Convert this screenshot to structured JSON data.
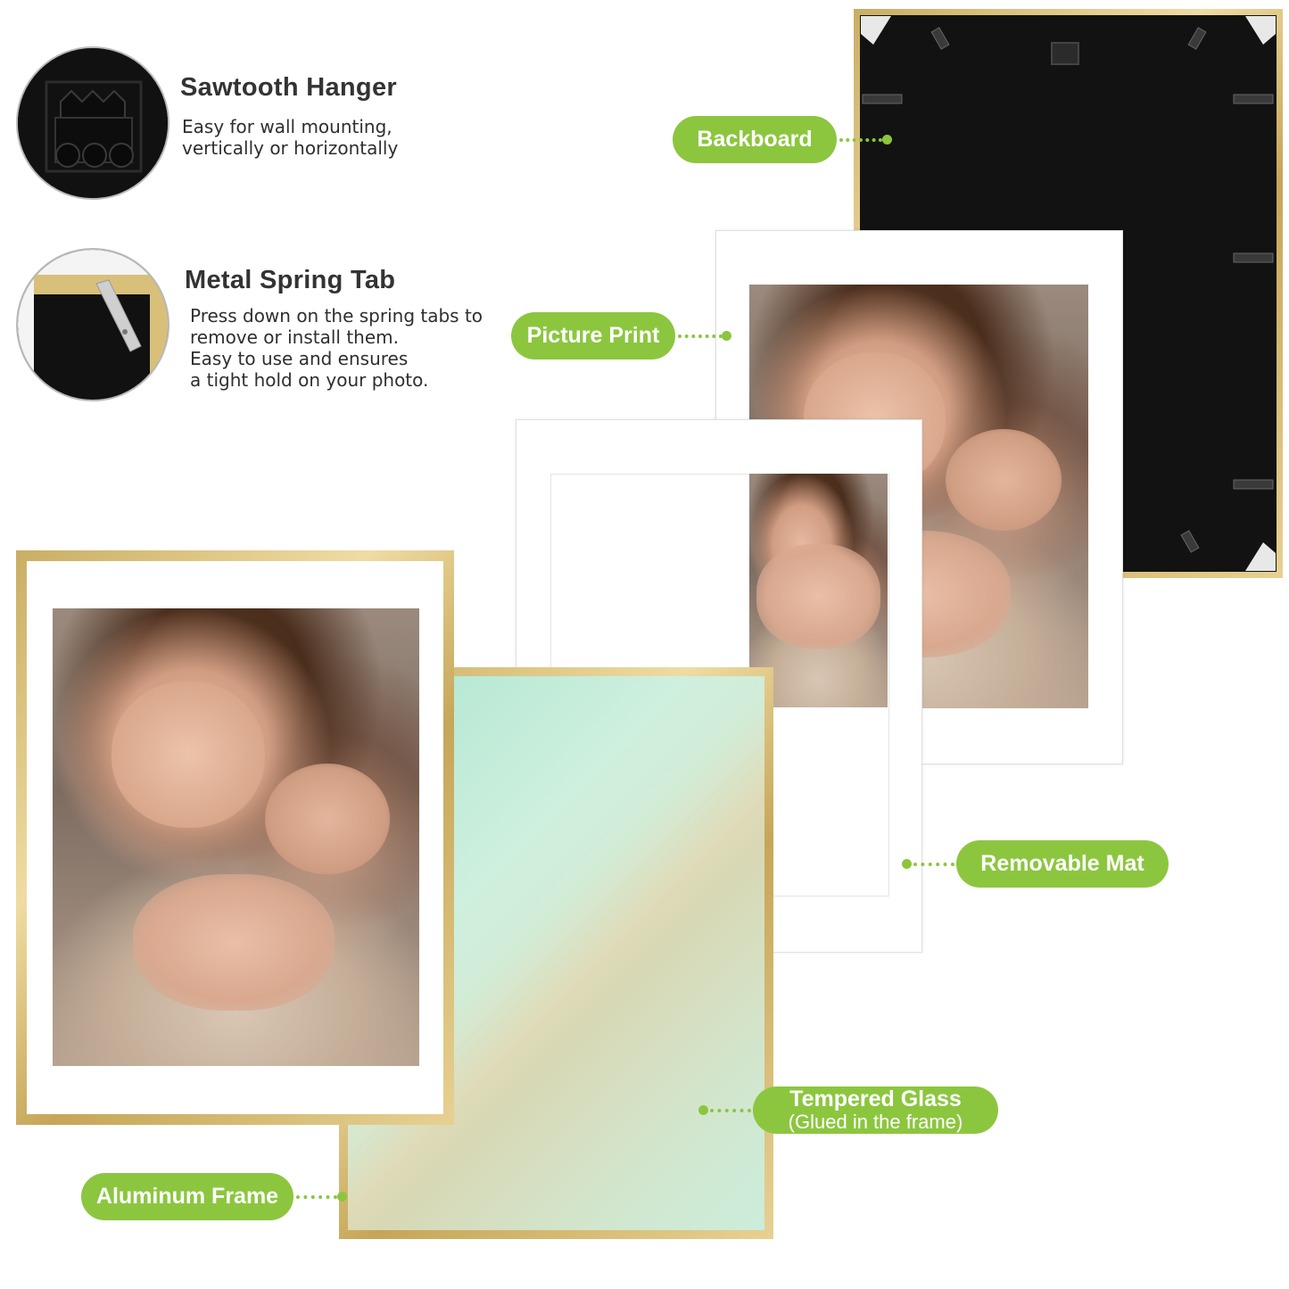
{
  "features": [
    {
      "title": "Sawtooth Hanger",
      "text": "Easy for wall mounting,\nvertically or horizontally",
      "icon": "sawtooth-hanger-icon"
    },
    {
      "title": "Metal Spring Tab",
      "text": "Press down on the spring tabs to\nremove or install them.\nEasy to use and ensures\na tight hold on your photo.",
      "icon": "spring-tab-icon"
    }
  ],
  "labels": {
    "backboard": "Backboard",
    "picture_print": "Picture Print",
    "removable_mat": "Removable Mat",
    "tempered_glass": "Tempered Glass",
    "tempered_glass_sub": "(Glued in the frame)",
    "aluminum_frame": "Aluminum Frame"
  },
  "colors": {
    "accent_green": "#8cc63f",
    "frame_gold": "#d8c07a",
    "backboard_black": "#111111"
  }
}
